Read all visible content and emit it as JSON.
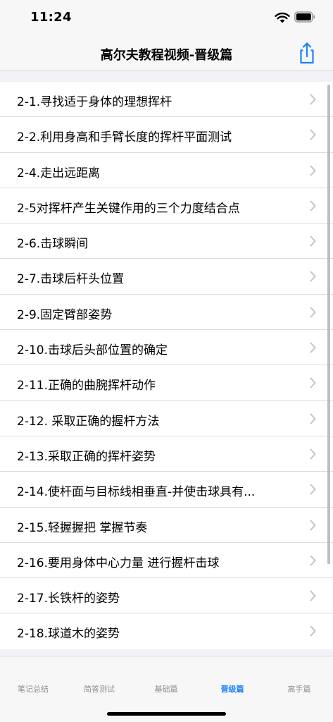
{
  "status_bar": {
    "time": "11:24"
  },
  "nav": {
    "title": "高尔夫教程视频-晋级篇",
    "share_icon": "share-icon"
  },
  "accent_color": "#1a82ff",
  "items": [
    {
      "label": "2-1.寻找适于身体的理想挥杆"
    },
    {
      "label": "2-2.利用身高和手臂长度的挥杆平面测试"
    },
    {
      "label": "2-4.走出远距离"
    },
    {
      "label": "2-5对挥杆产生关键作用的三个力度结合点"
    },
    {
      "label": "2-6.击球瞬间"
    },
    {
      "label": "2-7.击球后杆头位置"
    },
    {
      "label": "2-9.固定臂部姿势"
    },
    {
      "label": "2-10.击球后头部位置的确定"
    },
    {
      "label": "2-11.正确的曲腕挥杆动作"
    },
    {
      "label": "2-12. 采取正确的握杆方法"
    },
    {
      "label": "2-13.采取正确的挥杆姿势"
    },
    {
      "label": "2-14.使杆面与目标线相垂直-并使击球具有..."
    },
    {
      "label": "2-15.轻握握把 掌握节奏"
    },
    {
      "label": "2-16.要用身体中心力量 进行握杆击球"
    },
    {
      "label": "2-17.长铁杆的姿势"
    },
    {
      "label": "2-18.球道木的姿势"
    }
  ],
  "tabs": [
    {
      "label": "笔记总结",
      "active": false
    },
    {
      "label": "简答测试",
      "active": false
    },
    {
      "label": "基础篇",
      "active": false
    },
    {
      "label": "晋级篇",
      "active": true
    },
    {
      "label": "高手篇",
      "active": false
    }
  ]
}
